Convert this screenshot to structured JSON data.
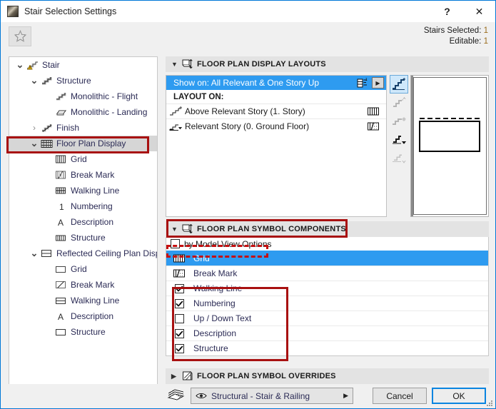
{
  "window": {
    "title": "Stair Selection Settings",
    "help_label": "?",
    "close_label": "✕",
    "favorite_icon": "star-icon"
  },
  "selection_info": {
    "stairs_selected_label": "Stairs Selected:",
    "stairs_selected_value": "1",
    "editable_label": "Editable:",
    "editable_value": "1"
  },
  "tree": {
    "items": [
      {
        "label": "Stair",
        "depth": 0,
        "twisty": "⌄",
        "icon": "stair-warning-icon",
        "selected": false
      },
      {
        "label": "Structure",
        "depth": 1,
        "twisty": "⌄",
        "icon": "structure-icon",
        "selected": false
      },
      {
        "label": "Monolithic - Flight",
        "depth": 2,
        "twisty": "",
        "icon": "monolithic-flight-icon",
        "selected": false
      },
      {
        "label": "Monolithic - Landing",
        "depth": 2,
        "twisty": "",
        "icon": "monolithic-landing-icon",
        "selected": false
      },
      {
        "label": "Finish",
        "depth": 1,
        "twisty": "›",
        "icon": "finish-icon",
        "selected": false
      },
      {
        "label": "Floor Plan Display",
        "depth": 1,
        "twisty": "⌄",
        "icon": "floor-plan-display-icon",
        "selected": true
      },
      {
        "label": "Grid",
        "depth": 2,
        "twisty": "",
        "icon": "grid-icon",
        "selected": false
      },
      {
        "label": "Break Mark",
        "depth": 2,
        "twisty": "",
        "icon": "break-mark-icon",
        "selected": false
      },
      {
        "label": "Walking Line",
        "depth": 2,
        "twisty": "",
        "icon": "walking-line-icon",
        "selected": false
      },
      {
        "label": "Numbering",
        "depth": 2,
        "twisty": "",
        "icon": "numbering-icon",
        "selected": false
      },
      {
        "label": "Description",
        "depth": 2,
        "twisty": "",
        "icon": "description-icon",
        "selected": false
      },
      {
        "label": "Structure",
        "depth": 2,
        "twisty": "",
        "icon": "structure-fill-icon",
        "selected": false
      },
      {
        "label": "Reflected Ceiling Plan Displa",
        "depth": 1,
        "twisty": "⌄",
        "icon": "rcp-display-icon",
        "selected": false
      },
      {
        "label": "Grid",
        "depth": 2,
        "twisty": "",
        "icon": "rcp-grid-icon",
        "selected": false
      },
      {
        "label": "Break Mark",
        "depth": 2,
        "twisty": "",
        "icon": "rcp-break-mark-icon",
        "selected": false
      },
      {
        "label": "Walking Line",
        "depth": 2,
        "twisty": "",
        "icon": "rcp-walking-line-icon",
        "selected": false
      },
      {
        "label": "Description",
        "depth": 2,
        "twisty": "",
        "icon": "rcp-description-icon",
        "selected": false
      },
      {
        "label": "Structure",
        "depth": 2,
        "twisty": "",
        "icon": "rcp-structure-icon",
        "selected": false
      }
    ],
    "scroll_left_icon": "‹",
    "scroll_right_icon": "›"
  },
  "layouts_section": {
    "title": "FLOOR PLAN DISPLAY LAYOUTS",
    "collapse_icon": "▼",
    "header_icon": "floor-plan-layouts-icon",
    "show_on_row": "Show on: All Relevant & One Story Up",
    "show_on_icon": "story-levels-icon",
    "show_on_arrow": "▶",
    "layout_on_label": "LAYOUT ON:",
    "rows": [
      {
        "label": "Above Relevant Story (1. Story)",
        "left_icon": "stair-above-icon",
        "right_icon": "grid-solid-icon"
      },
      {
        "label": "Relevant Story (0. Ground Floor)",
        "left_icon": "stair-relevant-icon",
        "right_icon": "grid-break-icon"
      }
    ]
  },
  "tool_column": {
    "buttons": [
      {
        "name": "story-view-above-active",
        "active": true
      },
      {
        "name": "story-view-b",
        "active": false
      },
      {
        "name": "story-view-c",
        "active": false
      },
      {
        "name": "story-view-d",
        "active": false
      },
      {
        "name": "story-view-e",
        "active": false
      }
    ]
  },
  "components_section": {
    "title": "FLOOR PLAN SYMBOL COMPONENTS",
    "collapse_icon": "▼",
    "header_icon": "floor-plan-components-icon",
    "by_mvo_label": "by Model View Options",
    "by_mvo_checked": false,
    "rows": [
      {
        "label": "Grid",
        "checkbox": false,
        "has_checkbox": false,
        "icon": "grid-solid-icon",
        "selected": true
      },
      {
        "label": "Break Mark",
        "checkbox": false,
        "has_checkbox": false,
        "icon": "grid-break-icon",
        "selected": false
      },
      {
        "label": "Walking Line",
        "checkbox": true,
        "has_checkbox": true,
        "icon": "",
        "selected": false
      },
      {
        "label": "Numbering",
        "checkbox": true,
        "has_checkbox": true,
        "icon": "",
        "selected": false
      },
      {
        "label": "Up / Down Text",
        "checkbox": false,
        "has_checkbox": true,
        "icon": "",
        "selected": false
      },
      {
        "label": "Description",
        "checkbox": true,
        "has_checkbox": true,
        "icon": "",
        "selected": false
      },
      {
        "label": "Structure",
        "checkbox": true,
        "has_checkbox": true,
        "icon": "",
        "selected": false
      }
    ]
  },
  "overrides_section": {
    "title": "FLOOR PLAN SYMBOL OVERRIDES",
    "collapse_icon": "▶",
    "header_icon": "floor-plan-overrides-icon"
  },
  "footer": {
    "layer_icon": "layers-icon",
    "layer_value": "Structural - Stair & Railing",
    "layer_eye_icon": "eye-icon",
    "layer_arrow": "▶",
    "cancel_label": "Cancel",
    "ok_label": "OK"
  },
  "colors": {
    "accent_blue": "#2e9bf0",
    "ok_border": "#0a84e0",
    "annotation_red": "#a81010",
    "title_bar": "#ffffff",
    "panel_bg": "#f0f0f0"
  }
}
